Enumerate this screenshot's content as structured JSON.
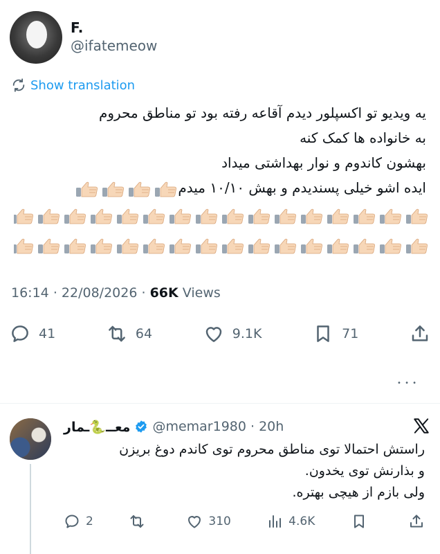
{
  "tweet": {
    "display_name": "F.",
    "handle": "@ifatemeow",
    "show_translation": "Show translation",
    "text_lines": [
      "یه ویدیو تو اکسپلور دیدم آقاعه رفته بود تو مناطق محروم",
      "به خانواده ها کمک کنه",
      "بهشون کاندوم و نوار بهداشتی میداد",
      "ایده اشو خیلی پسندیدم و بهش ۱۰/۱۰ میدم"
    ],
    "emoji": "thumbs-up",
    "emoji_after_line4": 4,
    "emoji_row2": 16,
    "emoji_row3": 16,
    "time": "16:14",
    "date": "22/08/2026",
    "views_count": "66K",
    "views_label": "Views",
    "actions": {
      "replies": "41",
      "retweets": "64",
      "likes": "9.1K",
      "bookmarks": "71"
    },
    "more_dots": "• • •"
  },
  "reply": {
    "display_name": "معــ🐍ـمار",
    "handle": "@memar1980",
    "time": "20h",
    "text_lines": [
      "راستش احتمالا توی مناطق محروم توی کاندم دوغ بریزن",
      "و بذارنش توی یخدون.",
      "ولی بازم از هیچی بهتره."
    ],
    "actions": {
      "replies": "2",
      "retweets": "",
      "likes": "310",
      "views": "4.6K"
    }
  },
  "colors": {
    "accent": "#1d9bf0",
    "muted": "#536471",
    "text": "#0f1419",
    "thumb": "#f7d7b8",
    "verified": "#1d9bf0"
  }
}
